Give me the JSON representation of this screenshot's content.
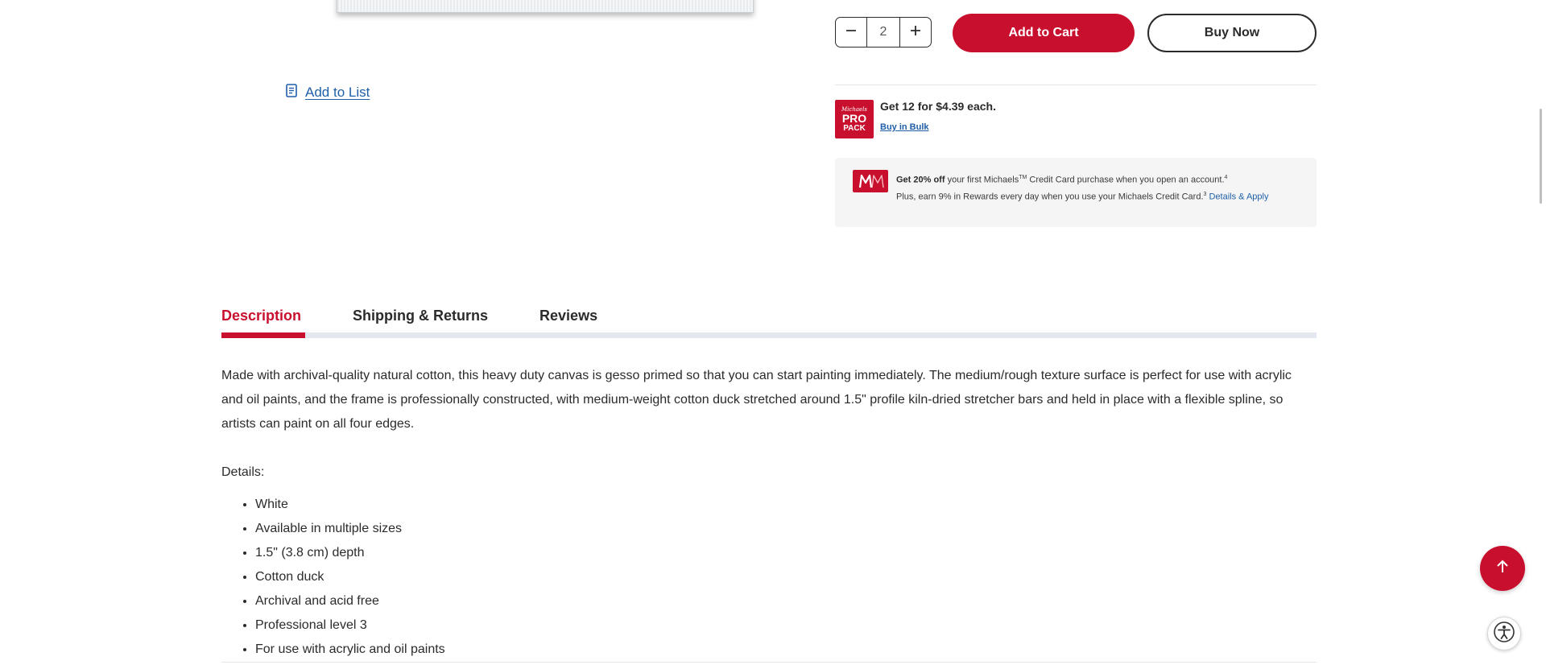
{
  "product": {
    "add_to_list": "Add to List",
    "quantity": "2",
    "add_to_cart": "Add to Cart",
    "buy_now": "Buy Now"
  },
  "bulk": {
    "badge": {
      "brand": "Michaels",
      "line1": "PRO",
      "line2": "PACK"
    },
    "offer": "Get 12 for $4.39 each.",
    "link": "Buy in Bulk"
  },
  "credit": {
    "bold": "Get 20% off",
    "text1": " your first Michaels",
    "tm": "TM",
    "text2": " Credit Card purchase when you open an account.",
    "sup1": "4",
    "text3": "Plus, earn 9% in Rewards every day when you use your Michaels Credit Card.",
    "sup2": "3",
    "link": "Details & Apply"
  },
  "tabs": [
    {
      "label": "Description",
      "active": true
    },
    {
      "label": "Shipping & Returns",
      "active": false
    },
    {
      "label": "Reviews",
      "active": false
    }
  ],
  "description": {
    "text": "Made with archival-quality natural cotton, this heavy duty canvas is gesso primed so that you can start painting immediately. The medium/rough texture surface is perfect for use with acrylic and oil paints, and the frame is professionally constructed, with medium-weight cotton duck stretched around 1.5\" profile kiln-dried stretcher bars and held in place with a flexible spline, so artists can paint on all four edges.",
    "details_label": "Details:",
    "details": [
      "White",
      "Available in multiple sizes",
      "1.5\" (3.8 cm) depth",
      "Cotton duck",
      "Archival and acid free",
      "Professional level 3",
      "For use with acrylic and oil paints"
    ]
  },
  "colors": {
    "accent": "#c8102e",
    "link": "#1f5fa8",
    "text": "#2b2b2b"
  }
}
